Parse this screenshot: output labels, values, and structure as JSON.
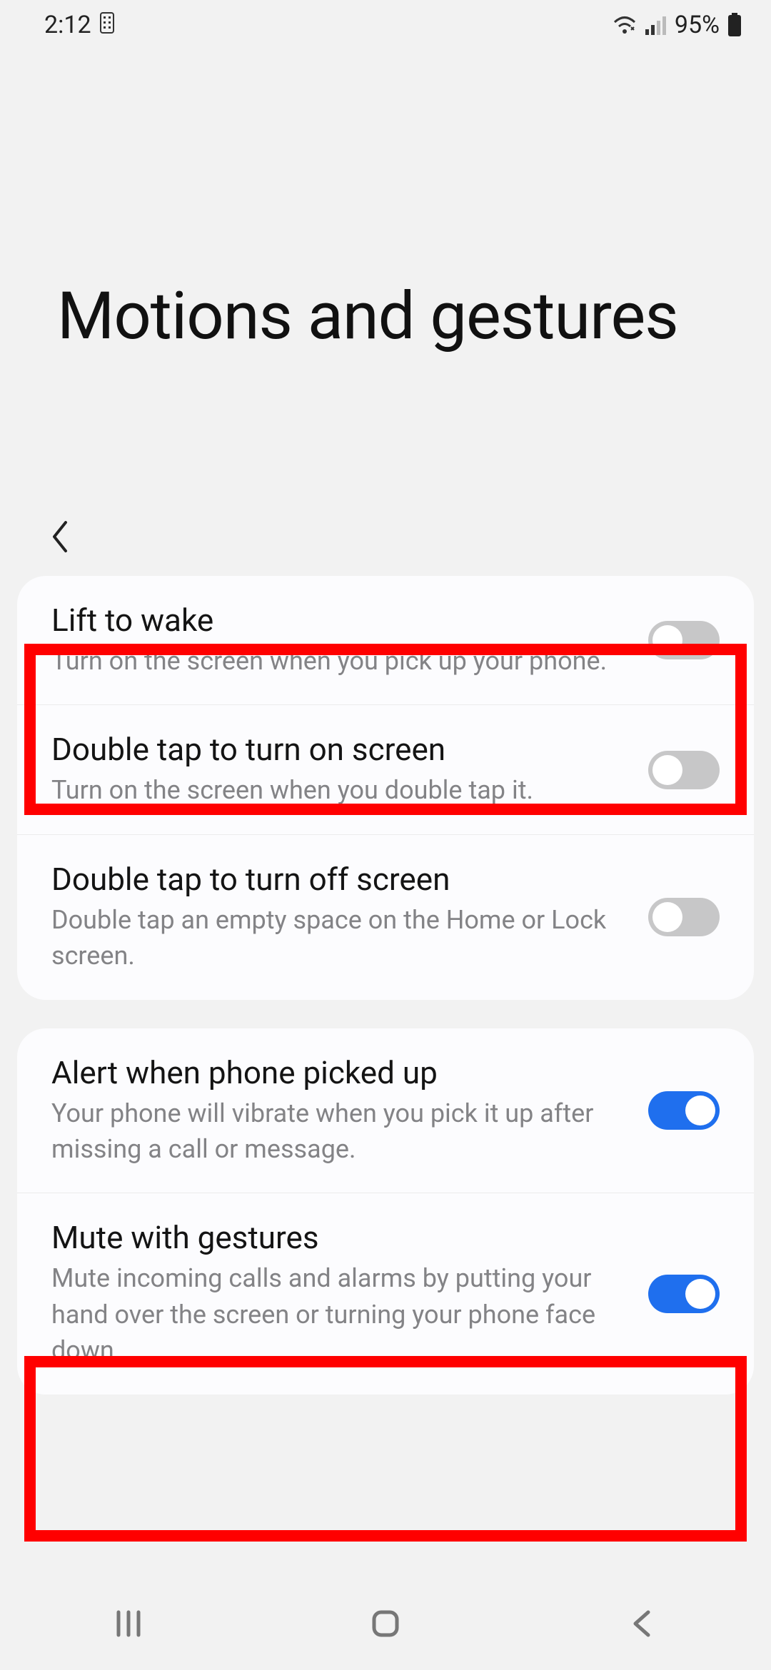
{
  "status": {
    "time": "2:12",
    "battery": "95%"
  },
  "header": {
    "title": "Motions and gestures"
  },
  "group1": [
    {
      "title": "Lift to wake",
      "desc": "Turn on the screen when you pick up your phone.",
      "on": false
    },
    {
      "title": "Double tap to turn on screen",
      "desc": "Turn on the screen when you double tap it.",
      "on": false
    },
    {
      "title": "Double tap to turn off screen",
      "desc": "Double tap an empty space on the Home or Lock screen.",
      "on": false
    }
  ],
  "group2": [
    {
      "title": "Alert when phone picked up",
      "desc": "Your phone will vibrate when you pick it up after missing a call or message.",
      "on": true
    },
    {
      "title": "Mute with gestures",
      "desc": "Mute incoming calls and alarms by putting your hand over the screen or turning your phone face down.",
      "on": true
    }
  ],
  "highlights": [
    0,
    4
  ],
  "highlight_color": "#ff0000"
}
